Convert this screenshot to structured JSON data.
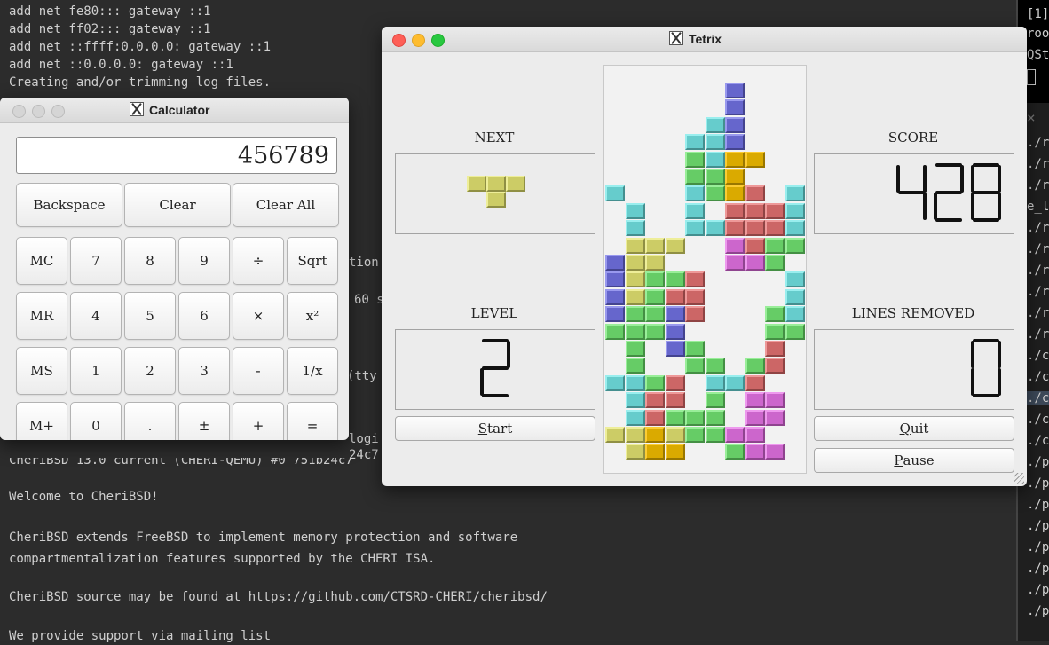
{
  "terminal": {
    "lines": [
      "add net fe80::: gateway ::1",
      "add net ff02::: gateway ::1",
      "add net ::ffff:0.0.0.0: gateway ::1",
      "add net ::0.0.0.0: gateway ::1",
      "Creating and/or trimming log files.",
      "Welcome to CheriBSD!",
      "CheriBSD extends FreeBSD to implement memory protection and software",
      "compartmentalization features supported by the CHERI ISA.",
      "CheriBSD source may be found at https://github.com/CTSRD-CHERI/cheribsd/",
      "We provide support via mailing list"
    ],
    "fragments": [
      "tion",
      "60 s",
      "(tty",
      "logi",
      "24c7",
      "CheriBSD 13.0 current (CHERI-QEMU) #0 751b24c7"
    ]
  },
  "right_terminal": {
    "top_lines": [
      "[1]",
      "roo",
      "QSt",
      "]"
    ],
    "close_glyph": "×",
    "lines": [
      "./r",
      "./r",
      "./r",
      "e_l",
      "./r",
      "./r",
      "./r",
      "./r",
      "./r",
      "./r",
      "./c",
      "./c",
      "./c",
      "./c",
      "./c",
      "./p",
      "./p",
      "./p",
      "./p",
      "./p",
      "./p",
      "./p",
      "./p"
    ]
  },
  "calculator": {
    "title": "Calculator",
    "display": "456789",
    "top_buttons": [
      "Backspace",
      "Clear",
      "Clear All"
    ],
    "rows": [
      [
        "MC",
        "7",
        "8",
        "9",
        "÷",
        "Sqrt"
      ],
      [
        "MR",
        "4",
        "5",
        "6",
        "×",
        "x²"
      ],
      [
        "MS",
        "1",
        "2",
        "3",
        "-",
        "1/x"
      ],
      [
        "M+",
        "0",
        ".",
        "±",
        "+",
        "="
      ]
    ]
  },
  "tetrix": {
    "title": "Tetrix",
    "next_label": "NEXT",
    "level_label": "LEVEL",
    "score_label": "SCORE",
    "lines_label": "LINES REMOVED",
    "level": "2",
    "score": "428",
    "lines_removed": "0",
    "start_label": "tart",
    "start_key": "S",
    "quit_label": "uit",
    "quit_key": "Q",
    "pause_label": "ause",
    "pause_key": "P",
    "colors": {
      "Y": [
        "#cccc66",
        "#eeee99",
        "#8f8f44"
      ],
      "C": [
        "#66cccc",
        "#99eeee",
        "#448f8f"
      ],
      "B": [
        "#6666cc",
        "#9999ee",
        "#44448f"
      ],
      "G": [
        "#66cc66",
        "#99ee99",
        "#448f44"
      ],
      "R": [
        "#cc6666",
        "#ee9999",
        "#8f4444"
      ],
      "M": [
        "#cc66cc",
        "#ee99ee",
        "#8f448f"
      ],
      "O": [
        "#daaa00",
        "#fccc33",
        "#997700"
      ]
    },
    "next_piece": [
      "YYY",
      ".Y."
    ],
    "board": [
      "......B...",
      "......B...",
      ".....CB...",
      "....CCB...",
      "....GCOO..",
      "....GGO...",
      "C...CGOR.C",
      ".C..C.RRRC",
      ".C..CCRRRC",
      ".YYY..MRGG",
      "BYY...MMG.",
      "BYGGR....C",
      "BYGRR....C",
      "BGGBR...GC",
      "GGGB....GG",
      ".G.BG...R.",
      ".G..GG.GR.",
      "CCGR.CCR..",
      ".CRR.G.MM.",
      ".CRGGG.MM.",
      "YYOYGGMM..",
      ".YOO..GMM."
    ]
  }
}
